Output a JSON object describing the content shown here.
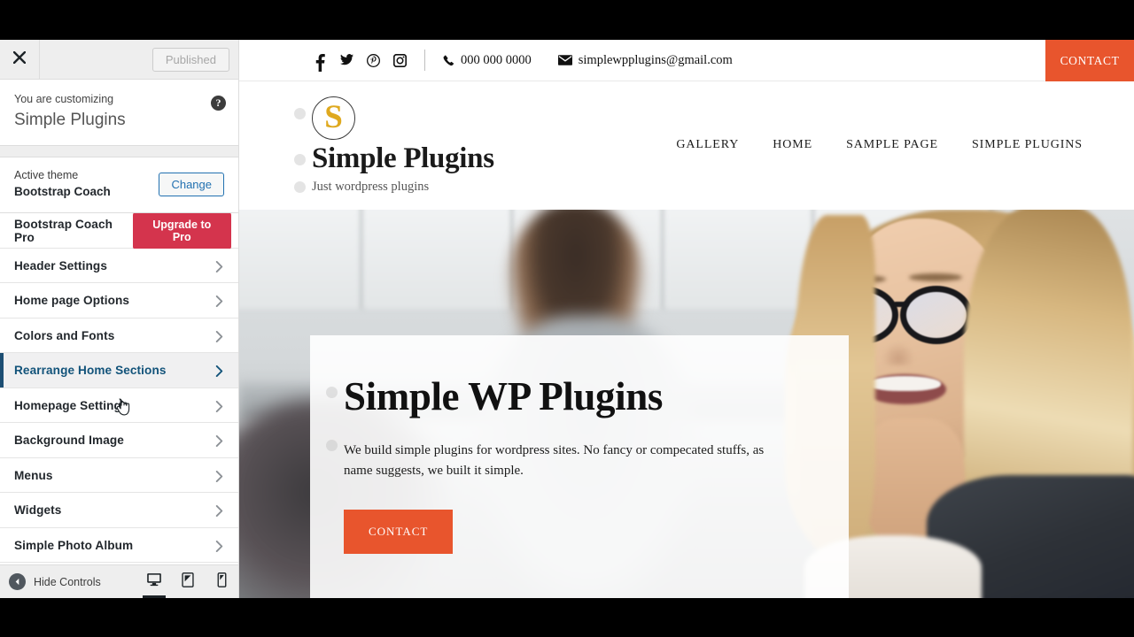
{
  "customizer": {
    "close_label": "Close customizer",
    "publish_label": "Published",
    "customizing_label": "You are customizing",
    "site_name": "Simple Plugins",
    "help_label": "?",
    "active_theme_label": "Active theme",
    "active_theme_name": "Bootstrap Coach",
    "change_label": "Change",
    "menu_items": [
      {
        "label": "Bootstrap Coach Pro",
        "type": "pro",
        "button_label": "Upgrade to Pro",
        "active": false
      },
      {
        "label": "Header Settings",
        "type": "nav",
        "active": false
      },
      {
        "label": "Home page Options",
        "type": "nav",
        "active": false
      },
      {
        "label": "Colors and Fonts",
        "type": "nav",
        "active": false
      },
      {
        "label": "Rearrange Home Sections",
        "type": "nav",
        "active": true
      },
      {
        "label": "Homepage Settings",
        "type": "nav",
        "active": false
      },
      {
        "label": "Background Image",
        "type": "nav",
        "active": false
      },
      {
        "label": "Menus",
        "type": "nav",
        "active": false
      },
      {
        "label": "Widgets",
        "type": "nav",
        "active": false
      },
      {
        "label": "Simple Photo Album",
        "type": "nav",
        "active": false
      }
    ],
    "footer": {
      "hide_controls_label": "Hide Controls",
      "devices": [
        {
          "name": "desktop",
          "active": true
        },
        {
          "name": "tablet",
          "active": false
        },
        {
          "name": "mobile",
          "active": false
        }
      ]
    }
  },
  "preview": {
    "topbar": {
      "social": [
        "facebook-icon",
        "twitter-icon",
        "pinterest-icon",
        "instagram-icon"
      ],
      "phone": "000 000 0000",
      "email": "simplewpplugins@gmail.com",
      "cta_label": "CONTACT"
    },
    "brand": {
      "logo_letter": "S",
      "site_title": "Simple Plugins",
      "tagline": "Just wordpress plugins"
    },
    "nav": [
      "GALLERY",
      "HOME",
      "SAMPLE PAGE",
      "SIMPLE PLUGINS"
    ],
    "hero": {
      "title": "Simple WP Plugins",
      "text": "We build simple plugins for wordpress sites. No fancy or compecated stuffs, as name suggests, we built it simple.",
      "button_label": "CONTACT"
    }
  },
  "colors": {
    "accent_orange": "#e8552d",
    "upgrade_red": "#d4344d",
    "logo_gold": "#dfa91e",
    "active_blue": "#12537a",
    "active_border": "#1d4e73"
  }
}
